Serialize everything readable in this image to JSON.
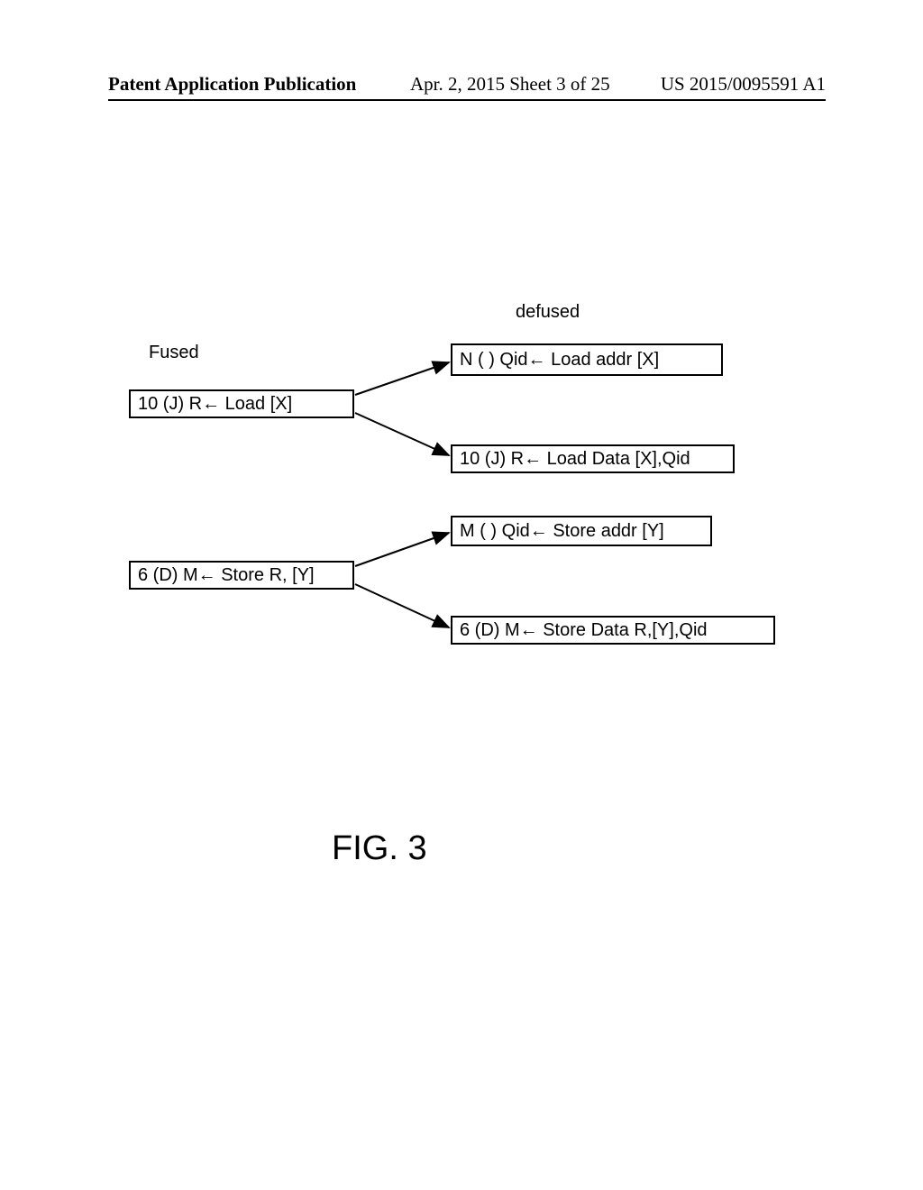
{
  "header": {
    "left": "Patent Application Publication",
    "mid": "Apr. 2, 2015  Sheet 3 of 25",
    "right": "US 2015/0095591 A1"
  },
  "labels": {
    "fused": "Fused",
    "defused": "defused"
  },
  "boxes": {
    "fused_load": "10 (J)    R← Load  [X]",
    "defused_load_addr": "N ( )    Qid←  Load addr [X]",
    "defused_load_data": "10  (J)  R← Load Data [X],Qid",
    "fused_store": "6  (D)   M← Store R,  [Y]",
    "defused_store_addr": "M ( ) Qid← Store addr [Y]",
    "defused_store_data": "6  (D)   M← Store Data  R,[Y],Qid"
  },
  "figure": {
    "caption": "FIG. 3"
  }
}
